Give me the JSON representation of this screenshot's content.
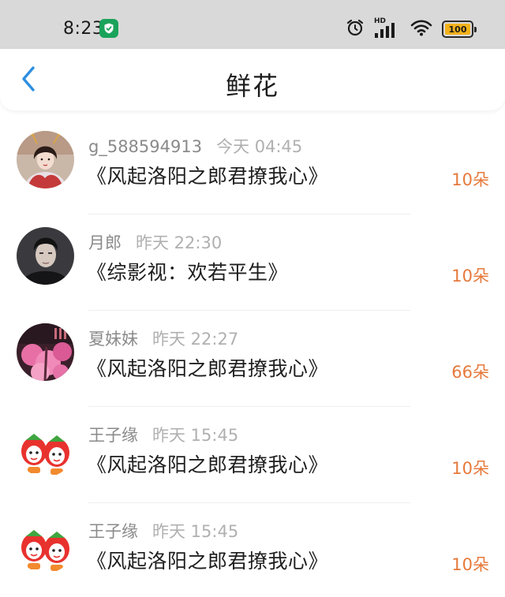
{
  "status_bar": {
    "time": "8:23",
    "battery_level": "100",
    "network_badge": "HD",
    "icons": [
      "shield-app-icon",
      "alarm-icon",
      "signal-icon",
      "wifi-icon",
      "battery-icon"
    ]
  },
  "header": {
    "title": "鲜花",
    "back_icon": "chevron-left-icon"
  },
  "colors": {
    "accent": "#2d8fe0",
    "amount": "#e6793b",
    "status_bar_bg": "#d9d9d9"
  },
  "gifts": [
    {
      "user": "g_588594913",
      "time": "今天 04:45",
      "book": "《风起洛阳之郎君撩我心》",
      "amount": "10朵",
      "avatar": "avatar-costume-lady"
    },
    {
      "user": "月郎",
      "time": "昨天 22:30",
      "book": "《综影视：欢若平生》",
      "amount": "10朵",
      "avatar": "avatar-dark-portrait"
    },
    {
      "user": "夏妹妹",
      "time": "昨天 22:27",
      "book": "《风起洛阳之郎君撩我心》",
      "amount": "66朵",
      "avatar": "avatar-pink-blossom"
    },
    {
      "user": "王子缘",
      "time": "昨天 15:45",
      "book": "《风起洛阳之郎君撩我心》",
      "amount": "10朵",
      "avatar": "avatar-strawberry-cartoon"
    },
    {
      "user": "王子缘",
      "time": "昨天 15:45",
      "book": "《风起洛阳之郎君撩我心》",
      "amount": "10朵",
      "avatar": "avatar-strawberry-cartoon"
    }
  ]
}
